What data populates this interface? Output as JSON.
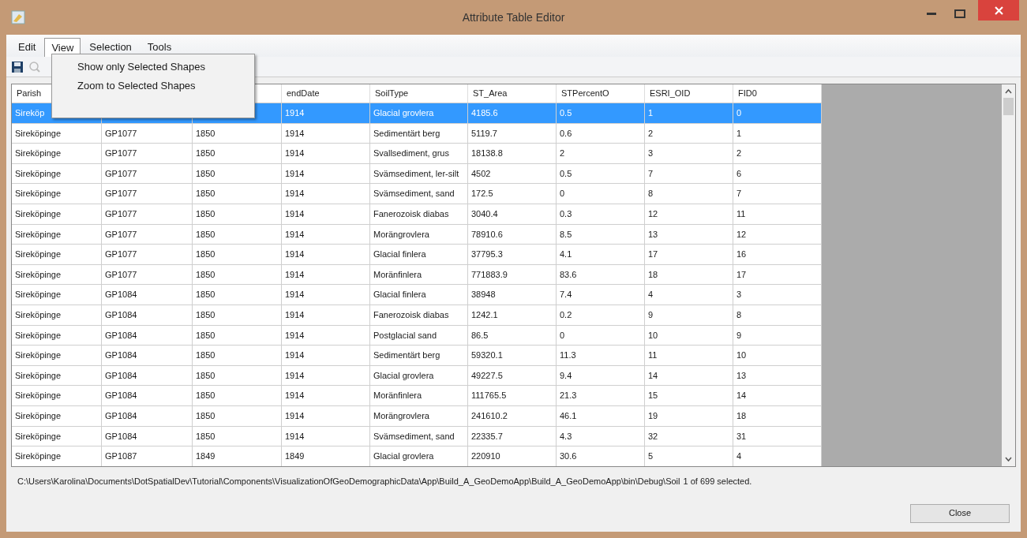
{
  "window": {
    "title": "Attribute Table Editor"
  },
  "menu": [
    {
      "label": "Edit",
      "selected": false
    },
    {
      "label": "View",
      "selected": true
    },
    {
      "label": "Selection",
      "selected": false
    },
    {
      "label": "Tools",
      "selected": false
    }
  ],
  "open_menu": {
    "items": [
      "Show only Selected Shapes",
      "Zoom to Selected Shapes"
    ]
  },
  "table": {
    "columns": [
      "Parish",
      null,
      null,
      "endDate",
      "SoilType",
      "ST_Area",
      "STPercentO",
      "ESRI_OID",
      "FID0"
    ],
    "rows": [
      {
        "selected": true,
        "cells": [
          "Sireköp",
          null,
          null,
          "1914",
          "Glacial grovlera",
          "4185.6",
          "0.5",
          "1",
          "0"
        ]
      },
      {
        "selected": false,
        "cells": [
          "Sireköpinge",
          "GP1077",
          "1850",
          "1914",
          "Sedimentärt berg",
          "5119.7",
          "0.6",
          "2",
          "1"
        ]
      },
      {
        "selected": false,
        "cells": [
          "Sireköpinge",
          "GP1077",
          "1850",
          "1914",
          "Svallsediment, grus",
          "18138.8",
          "2",
          "3",
          "2"
        ]
      },
      {
        "selected": false,
        "cells": [
          "Sireköpinge",
          "GP1077",
          "1850",
          "1914",
          "Svämsediment, ler-silt",
          "4502",
          "0.5",
          "7",
          "6"
        ]
      },
      {
        "selected": false,
        "cells": [
          "Sireköpinge",
          "GP1077",
          "1850",
          "1914",
          "Svämsediment, sand",
          "172.5",
          "0",
          "8",
          "7"
        ]
      },
      {
        "selected": false,
        "cells": [
          "Sireköpinge",
          "GP1077",
          "1850",
          "1914",
          "Fanerozoisk diabas",
          "3040.4",
          "0.3",
          "12",
          "11"
        ]
      },
      {
        "selected": false,
        "cells": [
          "Sireköpinge",
          "GP1077",
          "1850",
          "1914",
          "Morängrovlera",
          "78910.6",
          "8.5",
          "13",
          "12"
        ]
      },
      {
        "selected": false,
        "cells": [
          "Sireköpinge",
          "GP1077",
          "1850",
          "1914",
          "Glacial finlera",
          "37795.3",
          "4.1",
          "17",
          "16"
        ]
      },
      {
        "selected": false,
        "cells": [
          "Sireköpinge",
          "GP1077",
          "1850",
          "1914",
          "Moränfinlera",
          "771883.9",
          "83.6",
          "18",
          "17"
        ]
      },
      {
        "selected": false,
        "cells": [
          "Sireköpinge",
          "GP1084",
          "1850",
          "1914",
          "Glacial finlera",
          "38948",
          "7.4",
          "4",
          "3"
        ]
      },
      {
        "selected": false,
        "cells": [
          "Sireköpinge",
          "GP1084",
          "1850",
          "1914",
          "Fanerozoisk diabas",
          "1242.1",
          "0.2",
          "9",
          "8"
        ]
      },
      {
        "selected": false,
        "cells": [
          "Sireköpinge",
          "GP1084",
          "1850",
          "1914",
          "Postglacial sand",
          "86.5",
          "0",
          "10",
          "9"
        ]
      },
      {
        "selected": false,
        "cells": [
          "Sireköpinge",
          "GP1084",
          "1850",
          "1914",
          "Sedimentärt berg",
          "59320.1",
          "11.3",
          "11",
          "10"
        ]
      },
      {
        "selected": false,
        "cells": [
          "Sireköpinge",
          "GP1084",
          "1850",
          "1914",
          "Glacial grovlera",
          "49227.5",
          "9.4",
          "14",
          "13"
        ]
      },
      {
        "selected": false,
        "cells": [
          "Sireköpinge",
          "GP1084",
          "1850",
          "1914",
          "Moränfinlera",
          "111765.5",
          "21.3",
          "15",
          "14"
        ]
      },
      {
        "selected": false,
        "cells": [
          "Sireköpinge",
          "GP1084",
          "1850",
          "1914",
          "Morängrovlera",
          "241610.2",
          "46.1",
          "19",
          "18"
        ]
      },
      {
        "selected": false,
        "cells": [
          "Sireköpinge",
          "GP1084",
          "1850",
          "1914",
          "Svämsediment, sand",
          "22335.7",
          "4.3",
          "32",
          "31"
        ]
      },
      {
        "selected": false,
        "cells": [
          "Sireköpinge",
          "GP1087",
          "1849",
          "1849",
          "Glacial grovlera",
          "220910",
          "30.6",
          "5",
          "4"
        ]
      }
    ]
  },
  "status": {
    "path": "C:\\Users\\Karolina\\Documents\\DotSpatialDev\\Tutorial\\Components\\VisualizationOfGeoDemographicData\\App\\Build_A_GeoDemoApp\\Build_A_GeoDemoApp\\bin\\Debug\\Soil",
    "count": "1 of 699 selected."
  },
  "buttons": [
    "Close"
  ]
}
